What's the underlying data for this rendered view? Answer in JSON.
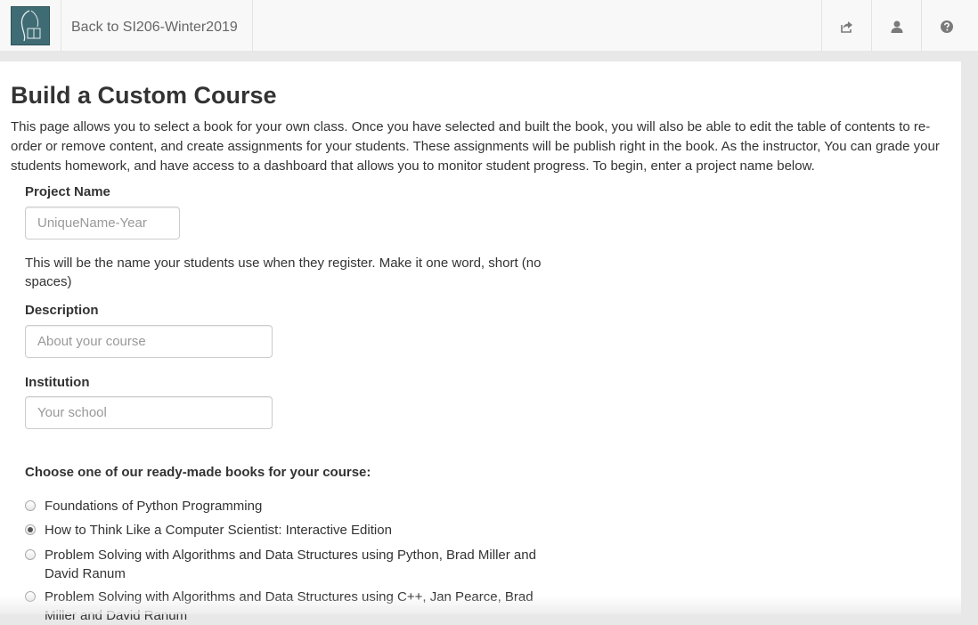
{
  "navbar": {
    "back_link": "Back to SI206-Winter2019",
    "icons": [
      "share-icon",
      "user-icon",
      "help-icon"
    ]
  },
  "page": {
    "title": "Build a Custom Course",
    "intro": "This page allows you to select a book for your own class. Once you have selected and built the book, you will also be able to edit the table of contents to re-order or remove content, and create assignments for your students. These assignments will be publish right in the book. As the instructor, You can grade your students homework, and have access to a dashboard that allows you to monitor student progress. To begin, enter a project name below."
  },
  "form": {
    "project_name": {
      "label": "Project Name",
      "placeholder": "UniqueName-Year",
      "help": "This will be the name your students use when they register. Make it one word, short (no spaces)"
    },
    "description": {
      "label": "Description",
      "placeholder": "About your course"
    },
    "institution": {
      "label": "Institution",
      "placeholder": "Your school"
    },
    "books_heading": "Choose one of our ready-made books for your course:",
    "books": [
      {
        "label": "Foundations of Python Programming",
        "checked": false
      },
      {
        "label": "How to Think Like a Computer Scientist: Interactive Edition",
        "checked": true
      },
      {
        "label": "Problem Solving with Algorithms and Data Structures using Python, Brad Miller and David Ranum",
        "checked": false
      },
      {
        "label": "Problem Solving with Algorithms and Data Structures using C++, Jan Pearce, Brad Miller and David Ranum",
        "checked": false
      }
    ]
  }
}
